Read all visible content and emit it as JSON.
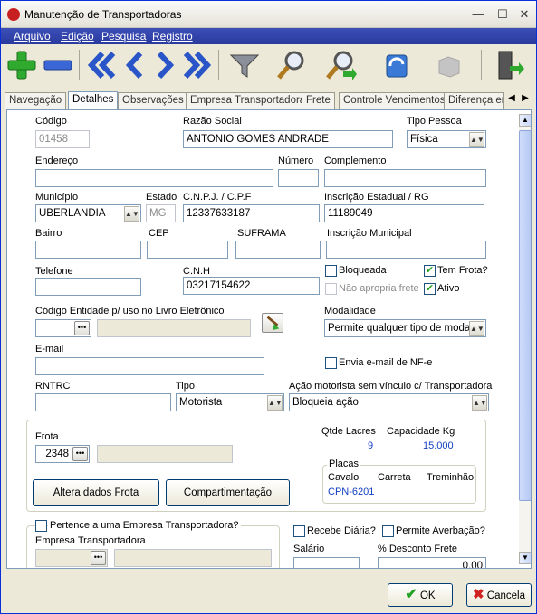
{
  "window": {
    "title": "Manutenção de Transportadoras",
    "min": "—",
    "max": "☐",
    "close": "✕"
  },
  "menu": [
    "Arquivo",
    "Edição",
    "Pesquisa",
    "Registro"
  ],
  "tabs": [
    "Navegação",
    "Detalhes",
    "Observações",
    "Empresa Transportadora",
    "Frete",
    "Controle Vencimentos",
    "Diferença en"
  ],
  "active_tab": "Detalhes",
  "form": {
    "codigo": {
      "label": "Código",
      "value": "01458"
    },
    "razao_social": {
      "label": "Razão Social",
      "value": "ANTONIO GOMES ANDRADE"
    },
    "tipo_pessoa": {
      "label": "Tipo Pessoa",
      "value": "Física"
    },
    "endereco": {
      "label": "Endereço",
      "value": ""
    },
    "numero": {
      "label": "Número",
      "value": ""
    },
    "complemento": {
      "label": "Complemento",
      "value": ""
    },
    "municipio": {
      "label": "Município",
      "value": "UBERLANDIA"
    },
    "estado": {
      "label": "Estado",
      "value": "MG"
    },
    "cnpj": {
      "label": "C.N.P.J. / C.P.F",
      "value": "12337633187"
    },
    "inscricao_estadual": {
      "label": "Inscrição Estadual / RG",
      "value": "11189049"
    },
    "bairro": {
      "label": "Bairro",
      "value": ""
    },
    "cep": {
      "label": "CEP",
      "value": ""
    },
    "suframa": {
      "label": "SUFRAMA",
      "value": ""
    },
    "inscricao_municipal": {
      "label": "Inscrição Municipal",
      "value": ""
    },
    "telefone": {
      "label": "Telefone",
      "value": ""
    },
    "cnh": {
      "label": "C.N.H",
      "value": "03217154622"
    },
    "bloqueada": {
      "label": "Bloqueada",
      "checked": false
    },
    "tem_frota": {
      "label": "Tem Frota?",
      "checked": true
    },
    "nao_apropria_frete": {
      "label": "Não apropria frete",
      "checked": false
    },
    "ativo": {
      "label": "Ativo",
      "checked": true
    },
    "codigo_entidade": {
      "label": "Código Entidade p/ uso no Livro Eletrônico",
      "value": ""
    },
    "modalidade": {
      "label": "Modalidade",
      "value": "Permite qualquer tipo de modalid‹"
    },
    "email": {
      "label": "E-mail",
      "value": ""
    },
    "envia_email": {
      "label": "Envia e-mail de NF-e",
      "checked": false
    },
    "rntrc": {
      "label": "RNTRC",
      "value": ""
    },
    "tipo": {
      "label": "Tipo",
      "value": "Motorista"
    },
    "acao_motorista": {
      "label": "Ação motorista sem vínculo c/ Transportadora",
      "value": "Bloqueia ação"
    }
  },
  "frota": {
    "label": "Frota",
    "value": "2348",
    "qtde_lacres_label": "Qtde Lacres",
    "qtde_lacres": "9",
    "capacidade_label": "Capacidade Kg",
    "capacidade": "15.000",
    "placas_label": "Placas",
    "cavalo_label": "Cavalo",
    "carreta_label": "Carreta",
    "treminhao_label": "Treminhão",
    "cavalo": "CPN-6201",
    "altera_btn": "Altera dados Frota",
    "compart_btn": "Compartimentação"
  },
  "empresa": {
    "pertence_label": "Pertence a uma Empresa Transportadora?",
    "pertence_checked": false,
    "empresa_label": "Empresa Transportadora",
    "recebe_diaria": "Recebe Diária?",
    "permite_averbacao": "Permite Averbação?",
    "salario_label": "Salário",
    "desconto_label": "% Desconto Frete",
    "desconto_value": "0,00"
  },
  "buttons": {
    "ok": "OK",
    "cancel": "Cancela"
  },
  "colors": {
    "menu": "#2a3a9e",
    "accent_blue": "#1340c0",
    "check_green": "#21a121"
  }
}
